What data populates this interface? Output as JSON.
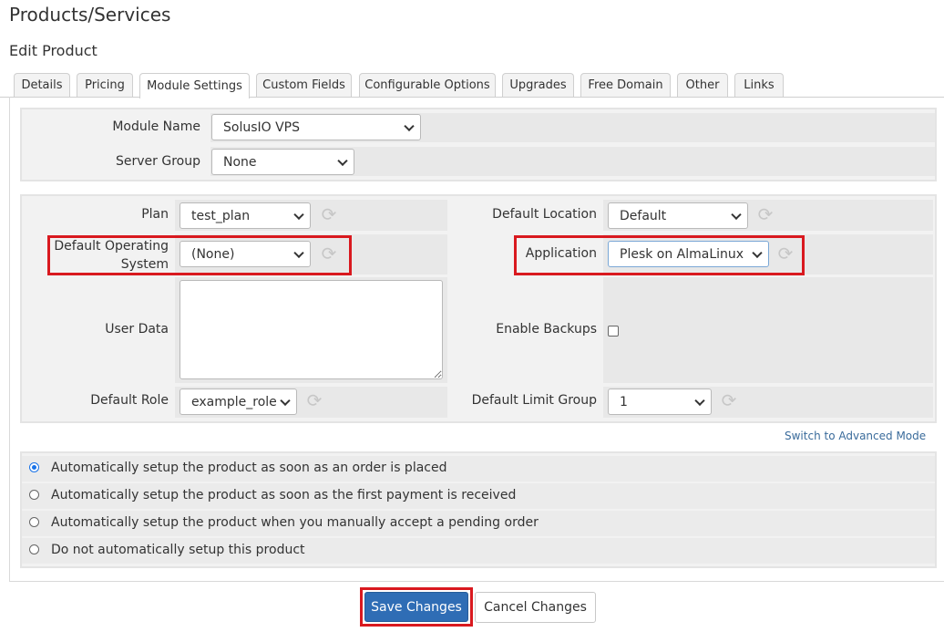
{
  "page": {
    "title": "Products/Services",
    "subtitle": "Edit Product"
  },
  "tabs": [
    {
      "label": "Details"
    },
    {
      "label": "Pricing"
    },
    {
      "label": "Module Settings",
      "active": true
    },
    {
      "label": "Custom Fields"
    },
    {
      "label": "Configurable Options"
    },
    {
      "label": "Upgrades"
    },
    {
      "label": "Free Domain"
    },
    {
      "label": "Other"
    },
    {
      "label": "Links"
    }
  ],
  "module": {
    "module_name_label": "Module Name",
    "module_name_value": "SolusIO VPS",
    "server_group_label": "Server Group",
    "server_group_value": "None"
  },
  "settings": {
    "plan_label": "Plan",
    "plan_value": "test_plan",
    "default_os_label_1": "Default Operating",
    "default_os_label_2": "System",
    "default_os_value": "(None)",
    "user_data_label": "User Data",
    "user_data_value": "",
    "default_role_label": "Default Role",
    "default_role_value": "example_role",
    "default_location_label": "Default Location",
    "default_location_value": "Default",
    "application_label": "Application",
    "application_value": "Plesk on AlmaLinux",
    "enable_backups_label": "Enable Backups",
    "enable_backups_checked": false,
    "default_limit_group_label": "Default Limit Group",
    "default_limit_group_value": "1"
  },
  "advanced_link": "Switch to Advanced Mode",
  "setup_options": [
    {
      "label": "Automatically setup the product as soon as an order is placed",
      "checked": true
    },
    {
      "label": "Automatically setup the product as soon as the first payment is received",
      "checked": false
    },
    {
      "label": "Automatically setup the product when you manually accept a pending order",
      "checked": false
    },
    {
      "label": "Do not automatically setup this product",
      "checked": false
    }
  ],
  "buttons": {
    "save": "Save Changes",
    "cancel": "Cancel Changes"
  },
  "colors": {
    "highlight": "#d9191f",
    "primary_button": "#2f6db5",
    "link": "#3a6b9b"
  },
  "icons": {
    "refresh": "refresh-icon"
  }
}
